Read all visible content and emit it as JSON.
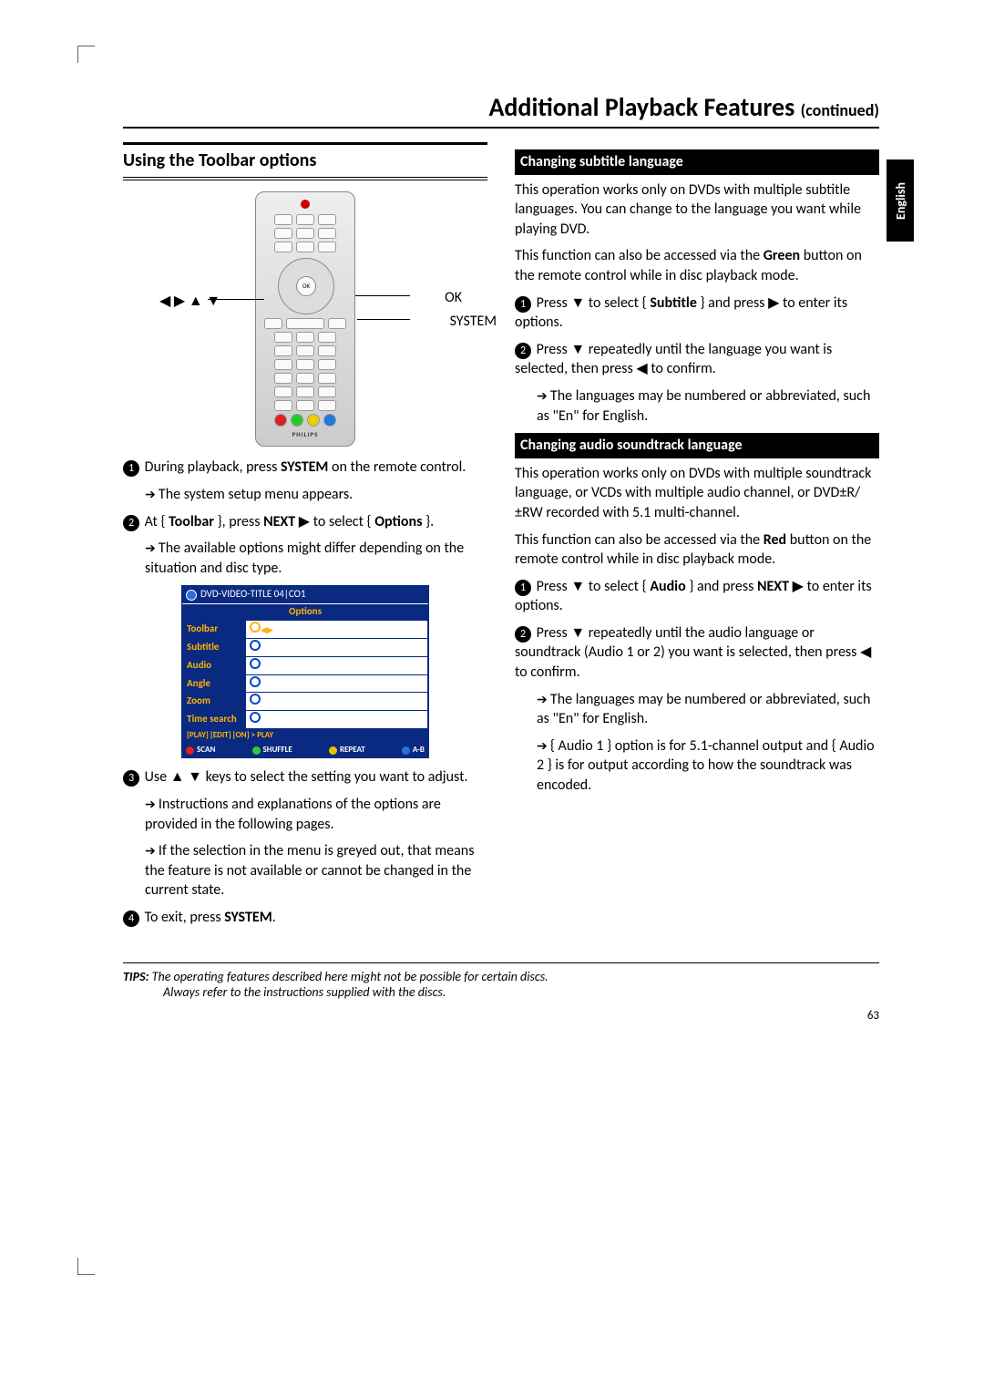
{
  "page_title_main": "Additional Playback Features ",
  "page_title_cont": "(continued)",
  "language_tab": "English",
  "page_number": "63",
  "left": {
    "heading": "Using the Toolbar options",
    "callouts": {
      "left": "◀ ▶ ▲ ▼",
      "ok": "OK",
      "system": "SYSTEM"
    },
    "remote_ok": "OK",
    "remote_brand": "PHILIPS",
    "step1_a": "During playback, press ",
    "step1_b": "SYSTEM",
    "step1_c": " on the remote control.",
    "step1_note": "The system setup menu appears.",
    "step2_a": "At { ",
    "step2_b": "Toolbar",
    "step2_c": " }, press ",
    "step2_d": "NEXT",
    "step2_e": " ▶  to select { ",
    "step2_f": "Options",
    "step2_g": " }.",
    "step2_note": "The available options might differ depending on the situation and disc type.",
    "menu": {
      "title": "DVD-VIDEO-TITLE 04|CO1",
      "options_label": "Options",
      "rows": [
        "Toolbar",
        "Subtitle",
        "Audio",
        "Angle",
        "Zoom",
        "Time search"
      ],
      "navline": "[PLAY] [EDIT] [ON] > PLAY",
      "bottom": {
        "scan": "SCAN",
        "shuffle": "SHUFFLE",
        "repeat": "REPEAT",
        "ab": "A-B"
      }
    },
    "step3_a": "Use ▲ ▼ keys to select the setting you want to adjust.",
    "step3_note1": "Instructions and explanations of the options are provided in the following pages.",
    "step3_note2": "If the selection in the menu is greyed out, that means the feature is not available or cannot be changed in the current state.",
    "step4_a": "To exit, press ",
    "step4_b": "SYSTEM",
    "step4_c": "."
  },
  "right": {
    "sub1": "Changing subtitle language",
    "p1": "This operation works only on DVDs with multiple subtitle languages. You can change to the language you want while playing DVD.",
    "p2a": "This function can also be accessed via the ",
    "p2b": "Green",
    "p2c": " button on the remote control while in disc playback mode.",
    "s1a": "Press ▼ to select { ",
    "s1b": "Subtitle",
    "s1c": " } and press ▶ to enter its options.",
    "s2": "Press ▼ repeatedly until the language you want is selected, then press ◀ to confirm.",
    "s2_note": "The languages may be numbered or abbreviated, such as \"En\" for English.",
    "sub2": "Changing audio soundtrack language",
    "p3": "This operation works only on DVDs with multiple soundtrack language, or VCDs with multiple audio channel, or DVD±R/±RW recorded with 5.1 multi-channel.",
    "p4a": "This function can also be accessed via the ",
    "p4b": "Red",
    "p4c": " button on the remote control while in disc playback mode.",
    "a1a": "Press ▼ to select { ",
    "a1b": "Audio",
    "a1c": " } and press ",
    "a1d": "NEXT",
    "a1e": " ▶  to enter its options.",
    "a2": "Press ▼ repeatedly until the audio language or soundtrack (Audio 1 or 2) you want is selected, then press ◀ to confirm.",
    "a2_note1": "The languages may be numbered or abbreviated, such as \"En\" for English.",
    "a2_note2": "{ Audio 1 } option is for 5.1-channel output and { Audio 2 } is for output according to how the soundtrack was encoded."
  },
  "tips": {
    "label": "TIPS:",
    "line1": "The operating features described here might not be possible for certain discs.",
    "line2": "Always refer to the instructions supplied with the discs."
  }
}
